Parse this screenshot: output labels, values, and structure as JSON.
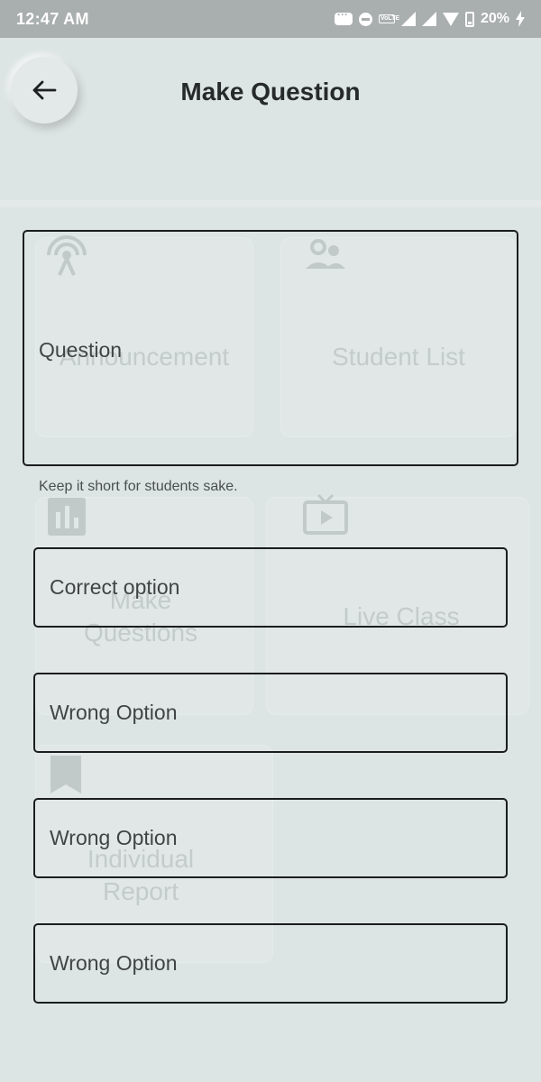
{
  "status_bar": {
    "time": "12:47 AM",
    "network": "VoLTE",
    "battery": "20%"
  },
  "header": {
    "title": "Make Question",
    "back_icon": "arrow-left-icon"
  },
  "background_menu": {
    "items": [
      {
        "label": "Announcement",
        "icon": "antenna-icon"
      },
      {
        "label": "Student List",
        "icon": "people-icon"
      },
      {
        "label": "Make\nQuestions",
        "icon": "bar-chart-icon"
      },
      {
        "label": "Live Class",
        "icon": "tv-play-icon"
      },
      {
        "label": "Individual\nReport",
        "icon": "bookmark-icon"
      }
    ]
  },
  "form": {
    "question_placeholder": "Question",
    "question_helper": "Keep it short for students sake.",
    "correct_option_placeholder": "Correct option",
    "wrong_option_placeholders": [
      "Wrong Option",
      "Wrong Option",
      "Wrong Option"
    ]
  },
  "colors": {
    "background": "#dde4e4",
    "status_bar": "#a9aeae",
    "border": "#1b1d1d"
  }
}
